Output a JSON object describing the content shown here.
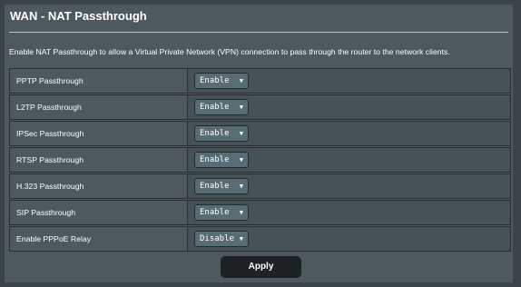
{
  "header": {
    "title": "WAN - NAT Passthrough"
  },
  "description": "Enable NAT Passthrough to allow a Virtual Private Network (VPN) connection to pass through the router to the network clients.",
  "settings": [
    {
      "label": "PPTP Passthrough",
      "value": "Enable"
    },
    {
      "label": "L2TP Passthrough",
      "value": "Enable"
    },
    {
      "label": "IPSec Passthrough",
      "value": "Enable"
    },
    {
      "label": "RTSP Passthrough",
      "value": "Enable"
    },
    {
      "label": "H.323 Passthrough",
      "value": "Enable"
    },
    {
      "label": "SIP Passthrough",
      "value": "Enable"
    },
    {
      "label": "Enable PPPoE Relay",
      "value": "Disable"
    }
  ],
  "select_arrow": "▼",
  "apply_label": "Apply",
  "colors": {
    "panel": "#4d595d",
    "divider": "#a8c9d6",
    "button": "#1f2224"
  }
}
